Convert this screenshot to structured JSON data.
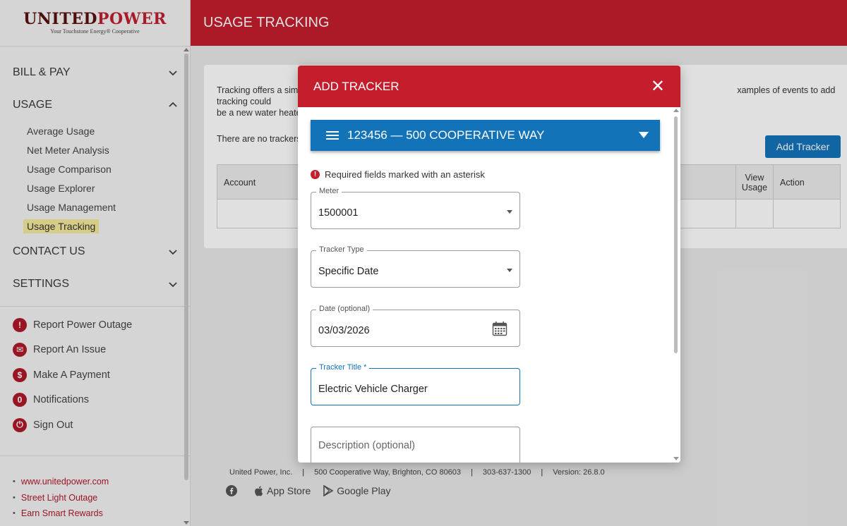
{
  "logo": {
    "brand_part1": "UNITED",
    "brand_part2": "POWER",
    "tagline": "Your Touchstone Energy® Cooperative"
  },
  "header": {
    "title": "USAGE TRACKING"
  },
  "sidebar": {
    "sections": [
      {
        "label": "BILL & PAY",
        "expanded": false
      },
      {
        "label": "USAGE",
        "expanded": true
      },
      {
        "label": "CONTACT US",
        "expanded": false
      },
      {
        "label": "SETTINGS",
        "expanded": false
      }
    ],
    "usage_items": [
      "Average Usage",
      "Net Meter Analysis",
      "Usage Comparison",
      "Usage Explorer",
      "Usage Management",
      "Usage Tracking"
    ],
    "quick_actions": [
      {
        "label": "Report Power Outage",
        "icon": "alert-icon",
        "glyph": "!"
      },
      {
        "label": "Report An Issue",
        "icon": "envelope-icon",
        "glyph": "✉"
      },
      {
        "label": "Make A Payment",
        "icon": "dollar-icon",
        "glyph": "$"
      },
      {
        "label": "Notifications",
        "icon": "notification-count-icon",
        "glyph": "0"
      },
      {
        "label": "Sign Out",
        "icon": "power-icon",
        "glyph": "⏻"
      }
    ],
    "links": [
      "www.unitedpower.com",
      "Street Light Outage",
      "Earn Smart Rewards"
    ]
  },
  "main": {
    "intro_text": "Tracking offers a simple way to see how usage changes before and after an event. Examples of events to add tracking could be a new water heater...",
    "intro_visible_left": "Tracking offers a sim",
    "intro_visible_left2": "be a new water heate",
    "intro_visible_right": "xamples of events to add tracking could",
    "no_trackers": "There are no trackers",
    "add_tracker_label": "Add Tracker",
    "table": {
      "col_account": "Account",
      "col_view_usage_1": "View",
      "col_view_usage_2": "Usage",
      "col_action": "Action"
    }
  },
  "footer": {
    "company": "United Power, Inc.",
    "address": "500 Cooperative Way, Brighton, CO 80603",
    "phone": "303-637-1300",
    "version": "Version: 26.8.0",
    "app_store": "App Store",
    "google_play": "Google Play"
  },
  "modal": {
    "title": "ADD TRACKER",
    "account_selector": "123456 — 500 COOPERATIVE WAY",
    "required_note": "Required fields marked with an asterisk",
    "fields": {
      "meter": {
        "label": "Meter",
        "value": "1500001"
      },
      "tracker_type": {
        "label": "Tracker Type",
        "value": "Specific Date"
      },
      "date": {
        "label": "Date (optional)",
        "value": "03/03/2026"
      },
      "tracker_title": {
        "label": "Tracker Title *",
        "value": "Electric Vehicle Charger"
      },
      "description": {
        "placeholder": "Description (optional)"
      }
    }
  },
  "colors": {
    "brand_red": "#c41e2d",
    "accent_blue": "#1373b9",
    "highlight": "#f3ea9a"
  }
}
